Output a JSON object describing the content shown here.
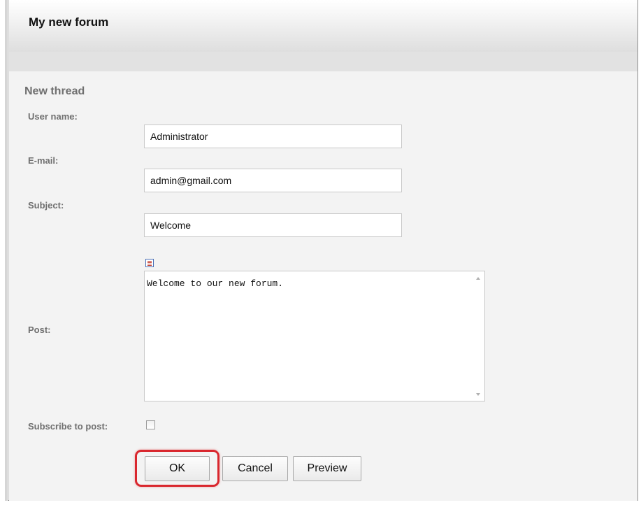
{
  "header": {
    "title": "My new forum"
  },
  "form": {
    "section_title": "New thread",
    "username": {
      "label": "User name:",
      "value": "Administrator"
    },
    "email": {
      "label": "E-mail:",
      "value": "admin@gmail.com"
    },
    "subject": {
      "label": "Subject:",
      "value": "Welcome"
    },
    "post": {
      "label": "Post:",
      "value": "Welcome to our new forum.",
      "toolbar_icon": "editor-icon"
    },
    "subscribe": {
      "label": "Subscribe to post:",
      "checked": false
    }
  },
  "buttons": {
    "ok": "OK",
    "cancel": "Cancel",
    "preview": "Preview"
  },
  "colors": {
    "highlight": "#d9272e",
    "label": "#707070",
    "background": "#f3f3f3"
  }
}
